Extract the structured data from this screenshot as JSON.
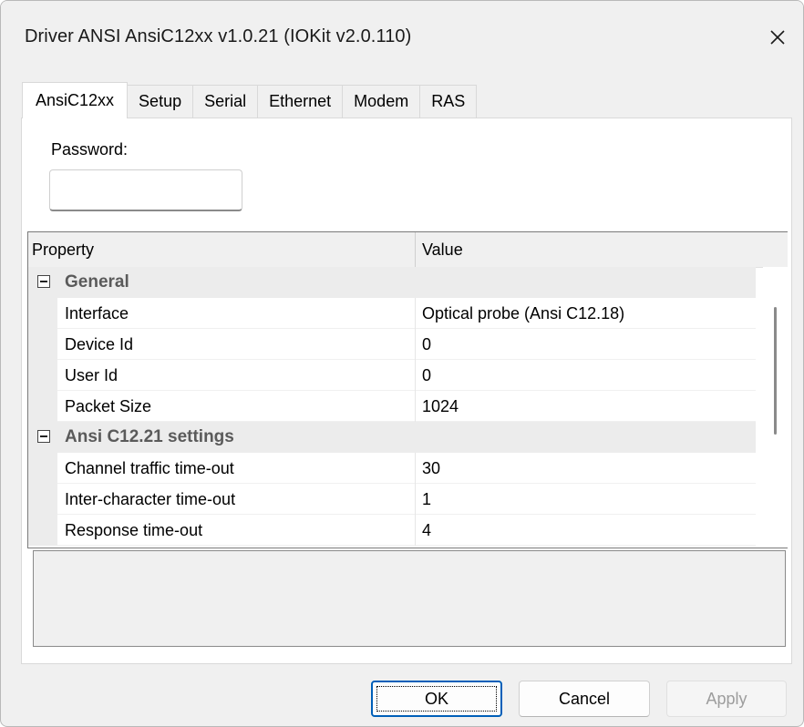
{
  "window": {
    "title": "Driver ANSI AnsiC12xx v1.0.21 (IOKit v2.0.110)",
    "close_icon": "close-icon"
  },
  "tabs": [
    {
      "label": "AnsiC12xx",
      "active": true
    },
    {
      "label": "Setup",
      "active": false
    },
    {
      "label": "Serial",
      "active": false
    },
    {
      "label": "Ethernet",
      "active": false
    },
    {
      "label": "Modem",
      "active": false
    },
    {
      "label": "RAS",
      "active": false
    }
  ],
  "password": {
    "label": "Password:",
    "value": ""
  },
  "grid": {
    "header": {
      "property": "Property",
      "value": "Value"
    },
    "categories": [
      {
        "label": "General",
        "expanded": true,
        "items": [
          {
            "name": "Interface",
            "value": "Optical probe (Ansi C12.18)"
          },
          {
            "name": "Device Id",
            "value": "0"
          },
          {
            "name": "User Id",
            "value": "0"
          },
          {
            "name": "Packet Size",
            "value": "1024"
          }
        ]
      },
      {
        "label": "Ansi C12.21 settings",
        "expanded": true,
        "items": [
          {
            "name": "Channel traffic time-out",
            "value": "30"
          },
          {
            "name": "Inter-character time-out",
            "value": "1"
          },
          {
            "name": "Response time-out",
            "value": "4"
          }
        ]
      }
    ]
  },
  "buttons": {
    "ok": "OK",
    "cancel": "Cancel",
    "apply": "Apply"
  },
  "colors": {
    "accent": "#005fb8",
    "dialog_bg": "#f0f0f0",
    "category_bg": "#ececec",
    "disabled_text": "#9d9d9d"
  }
}
